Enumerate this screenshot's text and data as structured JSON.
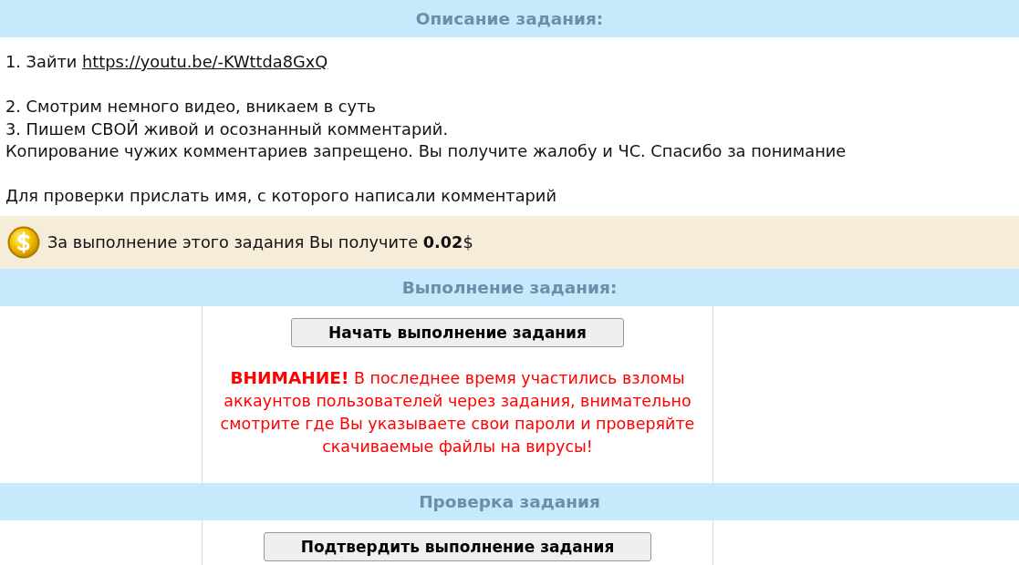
{
  "description": {
    "title": "Описание задания:",
    "blocks": [
      [
        {
          "text": "1. Зайти",
          "link": "https://youtu.be/-KWttda8GxQ"
        }
      ],
      [
        {
          "text": "2. Смотрим немного видео, вникаем в суть"
        },
        {
          "text": "3. Пишем СВОЙ живой и осознанный комментарий."
        },
        {
          "text": "Копирование чужих комментариев запрещено. Вы получите жалобу и ЧС. Спасибо за понимание"
        }
      ],
      [
        {
          "text": "Для проверки прислать имя, с которого написали комментарий"
        }
      ]
    ]
  },
  "reward": {
    "text": "За выполнение этого задания Вы получите **0.02**$"
  },
  "execution": {
    "title": "Выполнение задания:",
    "button": "Начать выполнение задания",
    "warning": "**ВНИМАНИЕ!** В последнее время участились взломы аккаунтов пользователей через задания, внимательно смотрите где Вы указываете свои пароли и проверяйте скачиваемые файлы на вирусы!"
  },
  "verification": {
    "title": "Проверка задания",
    "button": "Подтвердить выполнение задания"
  }
}
